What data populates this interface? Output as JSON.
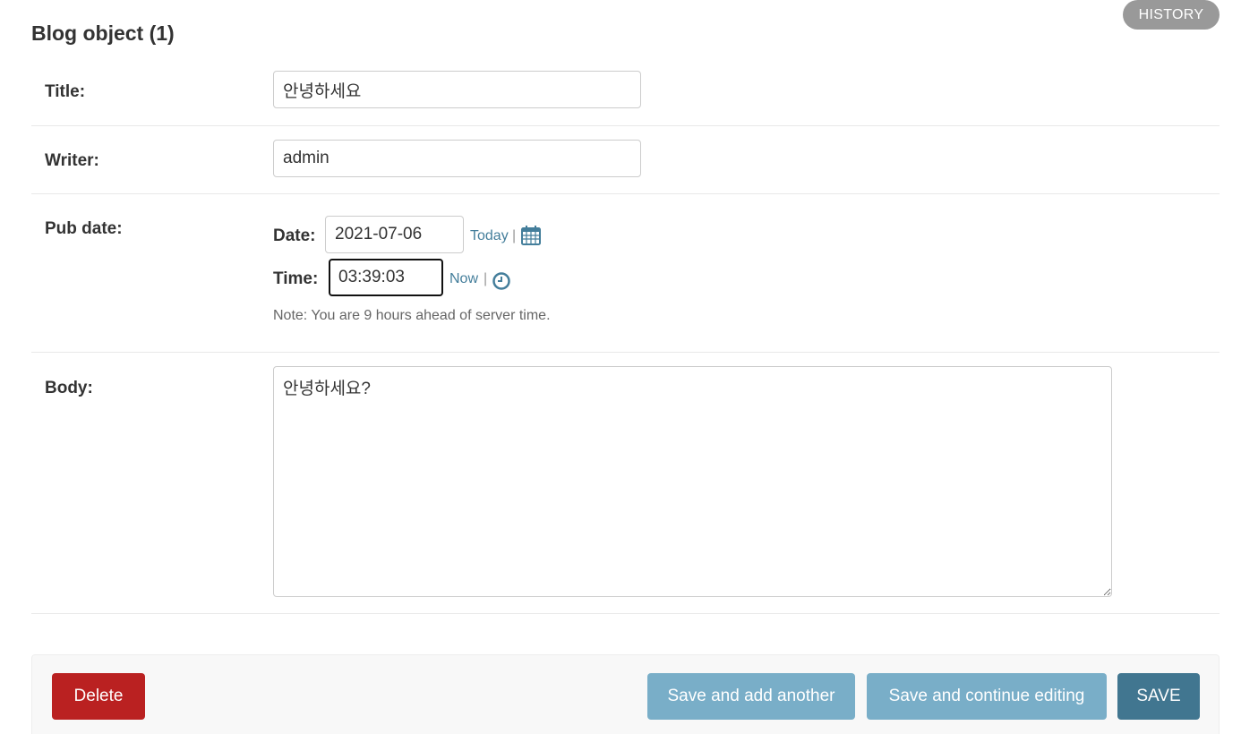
{
  "header": {
    "history_label": "HISTORY",
    "title": "Blog object (1)"
  },
  "fields": {
    "title": {
      "label": "Title:",
      "value": "안녕하세요"
    },
    "writer": {
      "label": "Writer:",
      "value": "admin"
    },
    "pub_date": {
      "label": "Pub date:",
      "date_label": "Date:",
      "date_value": "2021-07-06",
      "today_link": "Today",
      "time_label": "Time:",
      "time_value": "03:39:03",
      "now_link": "Now",
      "separator": "|",
      "calendar_icon": "calendar-icon",
      "clock_icon": "clock-icon",
      "note": "Note: You are 9 hours ahead of server time."
    },
    "body": {
      "label": "Body:",
      "value": "안녕하세요?"
    }
  },
  "actions": {
    "delete_label": "Delete",
    "save_add_label": "Save and add another",
    "save_continue_label": "Save and continue editing",
    "save_label": "SAVE"
  },
  "colors": {
    "link": "#447e9b",
    "delete": "#ba2121",
    "secondary_button": "#79aec8",
    "primary_button": "#417690",
    "history_button": "#999999"
  }
}
